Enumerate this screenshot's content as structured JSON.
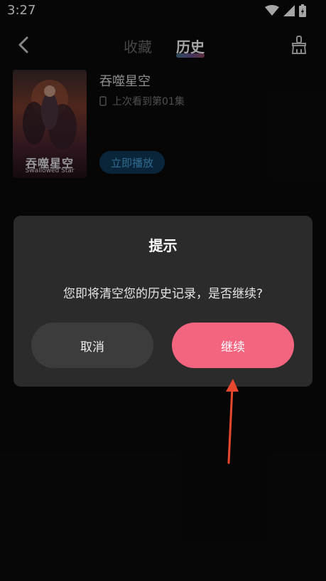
{
  "status_bar": {
    "time": "3:27"
  },
  "header": {
    "tabs": [
      {
        "label": "收藏",
        "active": false
      },
      {
        "label": "历史",
        "active": true
      }
    ]
  },
  "history_item": {
    "title": "吞噬星空",
    "progress": "上次看到第01集",
    "play_label": "立即播放",
    "poster": {
      "title": "吞噬星空",
      "subtitle": "Swallowed Star"
    }
  },
  "dialog": {
    "title": "提示",
    "message": "您即将清空您的历史记录，是否继续?",
    "cancel_label": "取消",
    "continue_label": "继续"
  },
  "colors": {
    "accent": "#f3657f",
    "dialog_bg": "#2b2b2b",
    "page_bg": "#0a0a0a",
    "annotation_arrow": "#e8472f"
  }
}
